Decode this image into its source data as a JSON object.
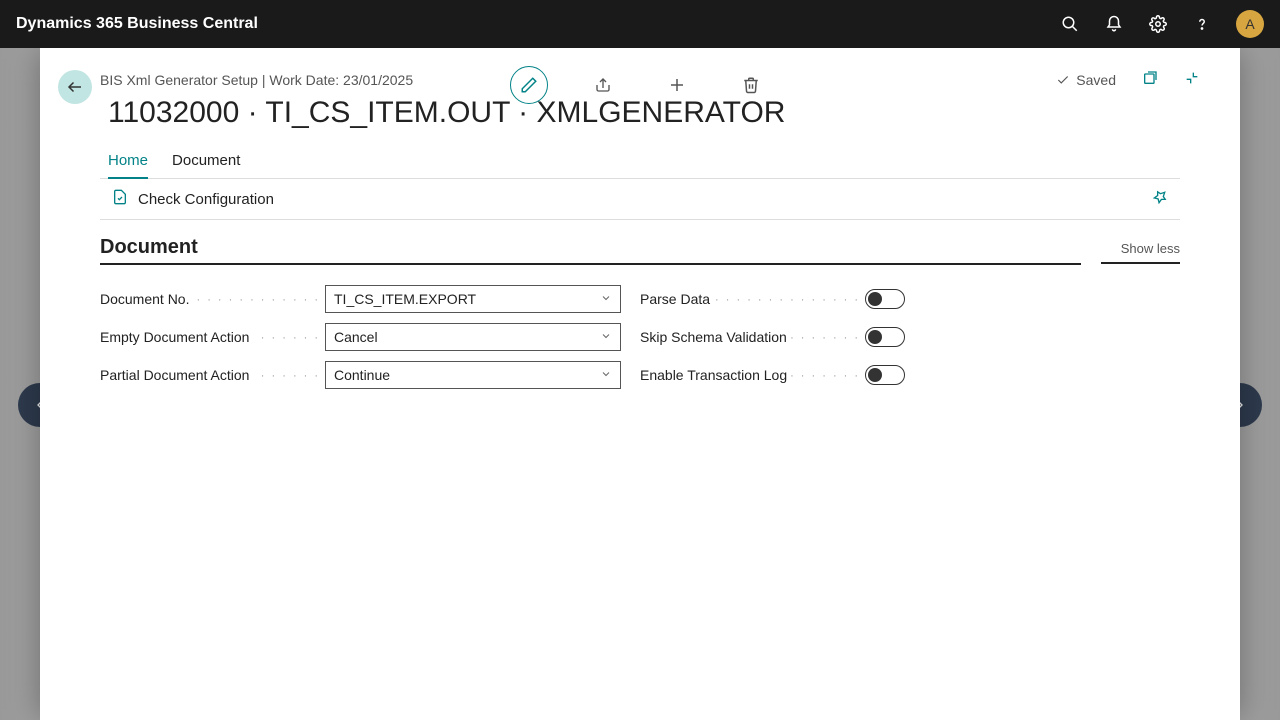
{
  "topbar": {
    "title": "Dynamics 365 Business Central",
    "avatar_letter": "A"
  },
  "header": {
    "breadcrumb": "BIS Xml Generator Setup | Work Date: 23/01/2025",
    "saved_label": "Saved"
  },
  "page_title": "11032000 · TI_CS_ITEM.OUT · XMLGENERATOR",
  "tabs": {
    "home": "Home",
    "document": "Document"
  },
  "action_bar": {
    "check_config": "Check Configuration"
  },
  "section": {
    "title": "Document",
    "show_less": "Show less"
  },
  "fields": {
    "document_no": {
      "label": "Document No.",
      "value": "TI_CS_ITEM.EXPORT"
    },
    "empty_doc_action": {
      "label": "Empty Document Action",
      "value": "Cancel"
    },
    "partial_doc_action": {
      "label": "Partial Document Action",
      "value": "Continue"
    },
    "parse_data": {
      "label": "Parse Data"
    },
    "skip_schema": {
      "label": "Skip Schema Validation"
    },
    "enable_txn": {
      "label": "Enable Transaction Log"
    }
  }
}
